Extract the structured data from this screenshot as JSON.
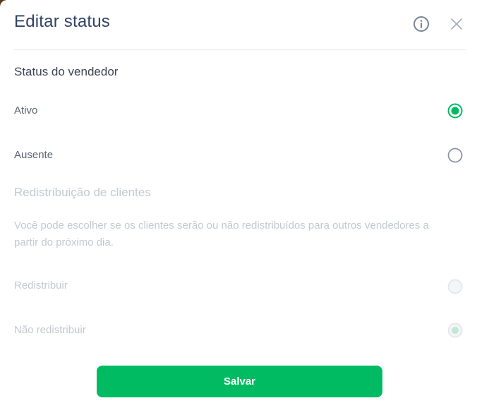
{
  "header": {
    "title": "Editar status",
    "info_icon": "info-icon",
    "close_icon": "close-icon"
  },
  "seller_status": {
    "title": "Status do vendedor",
    "options": [
      {
        "label": "Ativo",
        "selected": true,
        "disabled": false
      },
      {
        "label": "Ausente",
        "selected": false,
        "disabled": false
      }
    ]
  },
  "redistribution": {
    "title": "Redistribuição de clientes",
    "description": "Você pode escolher se os clientes serão ou não redistribuídos para outros vendedores a partir do próximo dia.",
    "options": [
      {
        "label": "Redistribuir",
        "selected": false,
        "disabled": true
      },
      {
        "label": "Não redistribuir",
        "selected": true,
        "disabled": true
      }
    ]
  },
  "footer": {
    "save_label": "Salvar"
  },
  "colors": {
    "accent": "#00bb62",
    "title": "#2f4366",
    "disabled_text": "#c4c8d0",
    "radio_border": "#8a93a6"
  }
}
